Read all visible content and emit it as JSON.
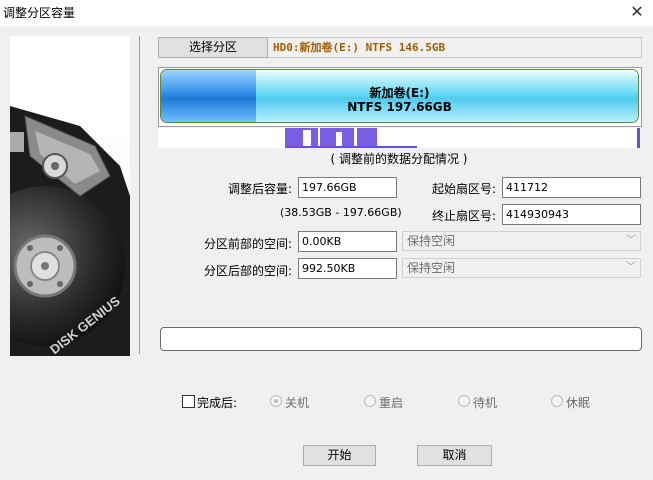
{
  "window": {
    "title": "调整分区容量"
  },
  "partition": {
    "select_button": "选择分区",
    "info": "HD0:新加卷(E:) NTFS 146.5GB",
    "bar_name": "新加卷(E:)",
    "bar_text": "NTFS 197.66GB",
    "used_fraction": 0.2
  },
  "map": {
    "caption": "( 调整前的数据分配情况 )"
  },
  "form": {
    "new_size_label": "调整后容量:",
    "new_size_value": "197.66GB",
    "range_text": "(38.53GB - 197.66GB)",
    "start_sector_label": "起始扇区号:",
    "start_sector_value": "411712",
    "end_sector_label": "终止扇区号:",
    "end_sector_value": "414930943",
    "space_before_label": "分区前部的空间:",
    "space_before_value": "0.00KB",
    "space_before_option": "保持空闲",
    "space_after_label": "分区后部的空间:",
    "space_after_value": "992.50KB",
    "space_after_option": "保持空闲"
  },
  "after_finish": {
    "label": "完成后:",
    "options": [
      "关机",
      "重启",
      "待机",
      "休眠"
    ]
  },
  "buttons": {
    "start": "开始",
    "cancel": "取消"
  },
  "side_logo_text": "DISK GENIUS"
}
